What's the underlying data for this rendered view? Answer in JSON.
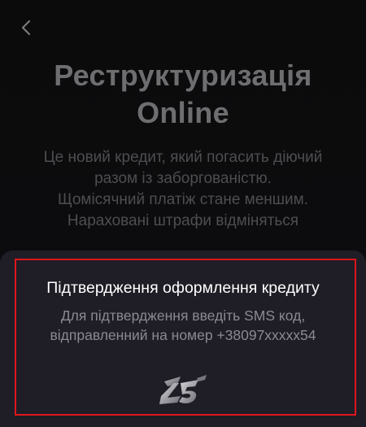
{
  "header": {
    "back_icon": "chevron-left-icon"
  },
  "hero": {
    "title_line1": "Реструктуризація",
    "title_line2": "Online",
    "description": [
      "Це новий кредит, який погасить діючий",
      "разом із заборгованістю.",
      "Щомісячний платіж стане меншим.",
      "Нараховані штрафи відміняться"
    ]
  },
  "confirm_sheet": {
    "title": "Підтвердження оформлення кредиту",
    "text_line1": "Для підтвердження введіть SMS код,",
    "text_line2": "відправленний на номер +38097xxxxx54",
    "loader_icon": "loading-logo-icon"
  },
  "colors": {
    "background": "#0b0b0c",
    "sheet": "#1f1d26",
    "highlight": "#e0161d",
    "title": "#6e6e70",
    "description": "#4e4e52"
  }
}
